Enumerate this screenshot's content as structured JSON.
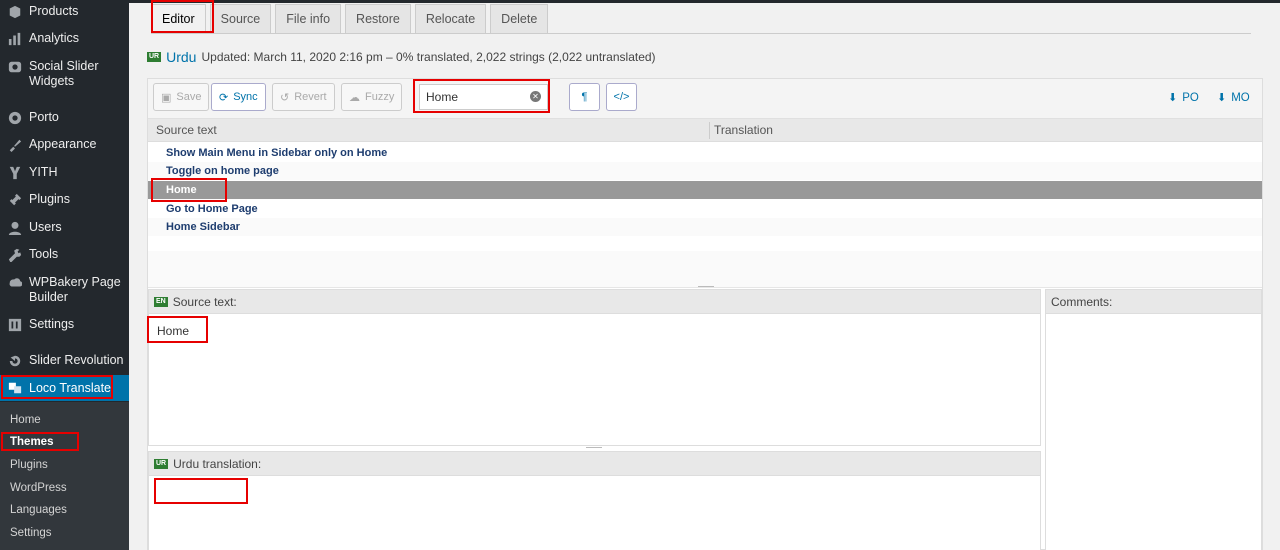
{
  "sidebar": {
    "items": [
      {
        "label": "Products",
        "icon": "products-icon"
      },
      {
        "label": "Analytics",
        "icon": "analytics-icon"
      },
      {
        "label": "Social Slider Widgets",
        "icon": "social-slider-icon"
      },
      {
        "label": "Porto",
        "icon": "porto-icon"
      },
      {
        "label": "Appearance",
        "icon": "appearance-icon"
      },
      {
        "label": "YITH",
        "icon": "yith-icon"
      },
      {
        "label": "Plugins",
        "icon": "plugins-icon"
      },
      {
        "label": "Users",
        "icon": "users-icon"
      },
      {
        "label": "Tools",
        "icon": "tools-icon"
      },
      {
        "label": "WPBakery Page Builder",
        "icon": "wpbakery-icon"
      },
      {
        "label": "Settings",
        "icon": "settings-icon"
      },
      {
        "label": "Slider Revolution",
        "icon": "slider-revolution-icon"
      },
      {
        "label": "Loco Translate",
        "icon": "loco-translate-icon"
      }
    ],
    "submenu": [
      "Home",
      "Themes",
      "Plugins",
      "WordPress",
      "Languages",
      "Settings"
    ]
  },
  "tabs": [
    "Editor",
    "Source",
    "File info",
    "Restore",
    "Relocate",
    "Delete"
  ],
  "locale": {
    "flag": "UR",
    "name": "Urdu",
    "summary": "Updated: March 11, 2020 2:16 pm – 0% translated, 2,022 strings (2,022 untranslated)"
  },
  "toolbar": {
    "save": "Save",
    "sync": "Sync",
    "revert": "Revert",
    "fuzzy": "Fuzzy",
    "filter_value": "Home",
    "pilcrow": "¶",
    "code": "</>",
    "po": "PO",
    "mo": "MO"
  },
  "grid": {
    "headers": [
      "Source text",
      "Translation"
    ],
    "rows": [
      "Show Main Menu in Sidebar only on Home",
      "Toggle on home page",
      "Home",
      "Go to Home Page",
      "Home Sidebar"
    ],
    "selected_index": 2
  },
  "source_pane": {
    "flag": "EN",
    "label": "Source text:",
    "value": "Home"
  },
  "translation_pane": {
    "flag": "UR",
    "label": "Urdu translation:",
    "value": ""
  },
  "comments_pane": {
    "label": "Comments:"
  },
  "colors": {
    "accent": "#0073aa",
    "highlight": "#e60000",
    "sidebar": "#23282d"
  }
}
